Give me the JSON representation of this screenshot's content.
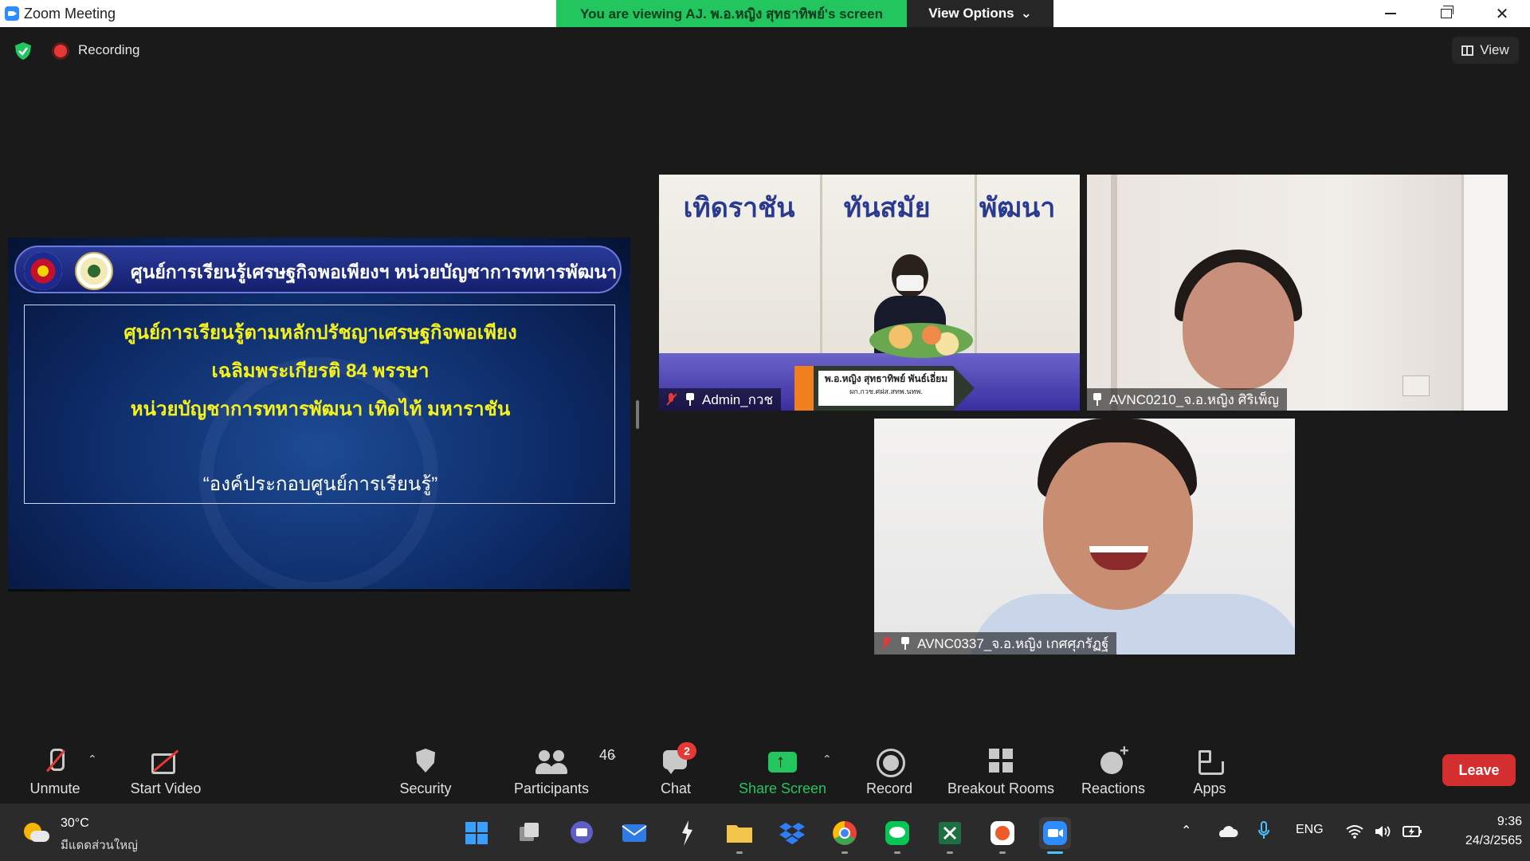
{
  "window": {
    "title": "Zoom Meeting",
    "viewing_banner": "You are viewing AJ. พ.อ.หญิง สุทธาทิพย์'s screen",
    "view_options_label": "View Options",
    "view_options_caret": "⌄",
    "minimize_icon": "minimize-icon",
    "maximize_icon": "restore-icon",
    "close_icon": "close-icon",
    "close_glyph": "✕"
  },
  "topbar": {
    "security_icon": "shield-check-icon",
    "recording_label": "Recording",
    "view_label": "View"
  },
  "shared_slide": {
    "header": "ศูนย์การเรียนรู้เศรษฐกิจพอเพียงฯ หน่วยบัญชาการทหารพัฒนา",
    "lines": [
      "ศูนย์การเรียนรู้ตามหลักปรัชญาเศรษฐกิจพอเพียง",
      "เฉลิมพระเกียรติ 84 พรรษา",
      "หน่วยบัญชาการทหารพัฒนา เทิดไท้ มหาราชัน"
    ],
    "quote": "“องค์ประกอบศูนย์การเรียนรู้”"
  },
  "participants_video": [
    {
      "name": "Admin_กวช",
      "muted": true,
      "banner_words": [
        "เทิดราชัน",
        "ทันสมัย",
        "พัฒนา"
      ],
      "nameplate_main": "พ.อ.หญิง สุทธาทิพย์ พันธ์เอี่ยม",
      "nameplate_sub": "ผก.กวช.ศฝส.สทพ.นทพ."
    },
    {
      "name": "AVNC0210_จ.อ.หญิง ศิริเพ็ญ",
      "muted": false
    },
    {
      "name": "AVNC0337_จ.อ.หญิง เกศศุภรัฏฐ์",
      "muted": true
    }
  ],
  "toolbar": {
    "unmute": "Unmute",
    "start_video": "Start Video",
    "security": "Security",
    "participants": "Participants",
    "participants_count": "46",
    "chat": "Chat",
    "chat_badge": "2",
    "share_screen": "Share Screen",
    "record": "Record",
    "breakout_rooms": "Breakout Rooms",
    "reactions": "Reactions",
    "apps": "Apps",
    "leave": "Leave",
    "caret": "⌃"
  },
  "taskbar": {
    "weather_temp": "30°C",
    "weather_desc": "มีแดดส่วนใหญ่",
    "language": "ENG",
    "time": "9:36",
    "date": "24/3/2565",
    "tray_caret": "⌃",
    "colors": {
      "start": "#3aa0ff",
      "taskview": "#d9d9d9",
      "teams": "#5b5fc7",
      "mail": "#2f7ae5",
      "files": "#f3c54b",
      "dropbox": "#2d7ff9",
      "chrome": "#34a853",
      "line": "#06c755",
      "excel": "#1d6f42",
      "photos": "#f05a28",
      "zoom": "#2d8cff"
    }
  },
  "colors": {
    "accent_green": "#22c55e",
    "leave_red": "#d32f2f",
    "background": "#1a1a1a"
  }
}
